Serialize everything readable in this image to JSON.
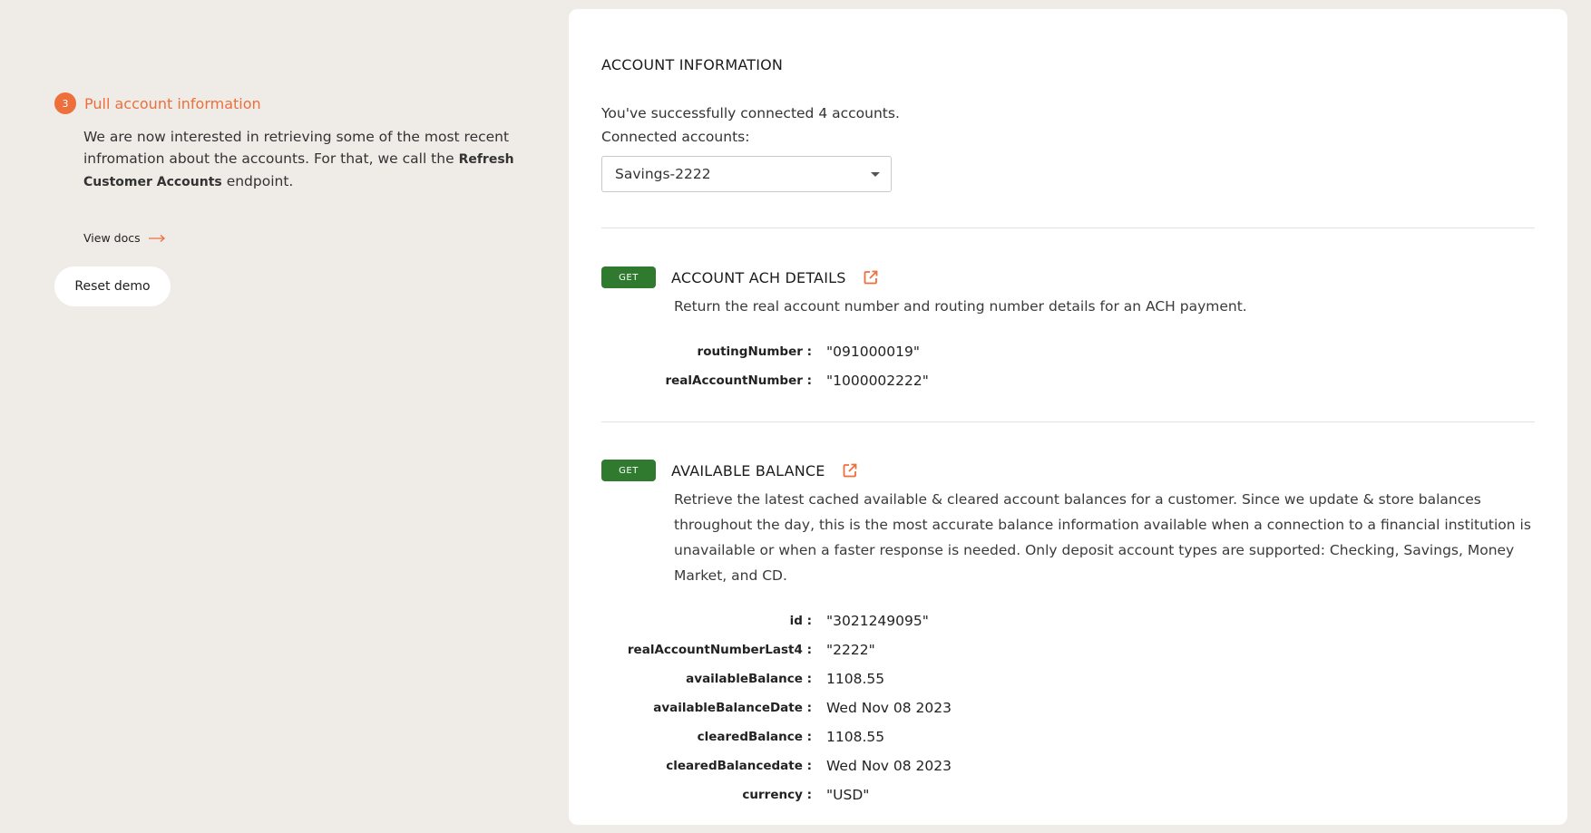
{
  "step": {
    "number": "3",
    "title": "Pull account information",
    "description_before": "We are now interested in retrieving some of the most recent infromation about the accounts. For that, we call the ",
    "description_bold": "Refresh Customer Accounts",
    "description_after": " endpoint.",
    "view_docs_label": "View docs",
    "reset_label": "Reset demo"
  },
  "card": {
    "title": "ACCOUNT INFORMATION",
    "success_text": "You've successfully connected 4 accounts.",
    "connected_label": "Connected accounts:",
    "selected_account": "Savings-2222"
  },
  "endpoints": [
    {
      "method": "GET",
      "title": "ACCOUNT ACH DETAILS",
      "description": "Return the real account number and routing number details for an ACH payment.",
      "fields": [
        {
          "key": "routingNumber :",
          "value": "\"091000019\""
        },
        {
          "key": "realAccountNumber :",
          "value": "\"1000002222\""
        }
      ]
    },
    {
      "method": "GET",
      "title": "AVAILABLE BALANCE",
      "description": "Retrieve the latest cached available & cleared account balances for a customer. Since we update & store balances throughout the day, this is the most accurate balance information available when a connection to a financial institution is unavailable or when a faster response is needed. Only deposit account types are supported: Checking, Savings, Money Market, and CD.",
      "fields": [
        {
          "key": "id :",
          "value": "\"3021249095\""
        },
        {
          "key": "realAccountNumberLast4 :",
          "value": "\"2222\""
        },
        {
          "key": "availableBalance :",
          "value": "1108.55"
        },
        {
          "key": "availableBalanceDate :",
          "value": "Wed Nov 08 2023"
        },
        {
          "key": "clearedBalance :",
          "value": "1108.55"
        },
        {
          "key": "clearedBalancedate :",
          "value": "Wed Nov 08 2023"
        },
        {
          "key": "currency :",
          "value": "\"USD\""
        }
      ]
    }
  ],
  "colors": {
    "accent": "#ec6f3c",
    "get_badge": "#2f7a2f",
    "background": "#efece8"
  },
  "icons": {
    "external_link": "external-link-icon",
    "dropdown": "chevron-down-icon",
    "arrow": "arrow-right-icon"
  }
}
